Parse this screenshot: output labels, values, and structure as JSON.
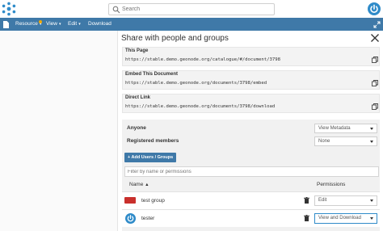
{
  "header": {
    "search_placeholder": "Search"
  },
  "navbar": {
    "items": [
      {
        "label": "Resource",
        "caret": "▾"
      },
      {
        "label": "View",
        "caret": "▾"
      },
      {
        "label": "Edit",
        "caret": "▾"
      },
      {
        "label": "Download",
        "caret": ""
      }
    ]
  },
  "share": {
    "title": "Share with people and groups",
    "links": [
      {
        "label": "This Page",
        "url": "https://stable.demo.geonode.org/catalogue/#/document/3798"
      },
      {
        "label": "Embed This Document",
        "url": "https://stable.demo.geonode.org/documents/3798/embed"
      },
      {
        "label": "Direct Link",
        "url": "https://stable.demo.geonode.org/documents/3798/download"
      }
    ],
    "general": [
      {
        "who": "Anyone",
        "permission": "View Metadata"
      },
      {
        "who": "Registered members",
        "permission": "None"
      }
    ],
    "add_button": "+ Add Users / Groups",
    "filter_placeholder": "Filter by name or permissions",
    "columns": {
      "name": "Name",
      "sort_indicator": "▲",
      "permissions": "Permissions"
    },
    "entries": [
      {
        "name": "test group",
        "type": "group",
        "permission": "Edit"
      },
      {
        "name": "tester",
        "type": "user",
        "permission": "View and Download"
      }
    ]
  },
  "colors": {
    "navbar": "#3f79a8",
    "accent": "#2f8bc9",
    "group_badge": "#c9302c",
    "notification": "#f2a900"
  }
}
